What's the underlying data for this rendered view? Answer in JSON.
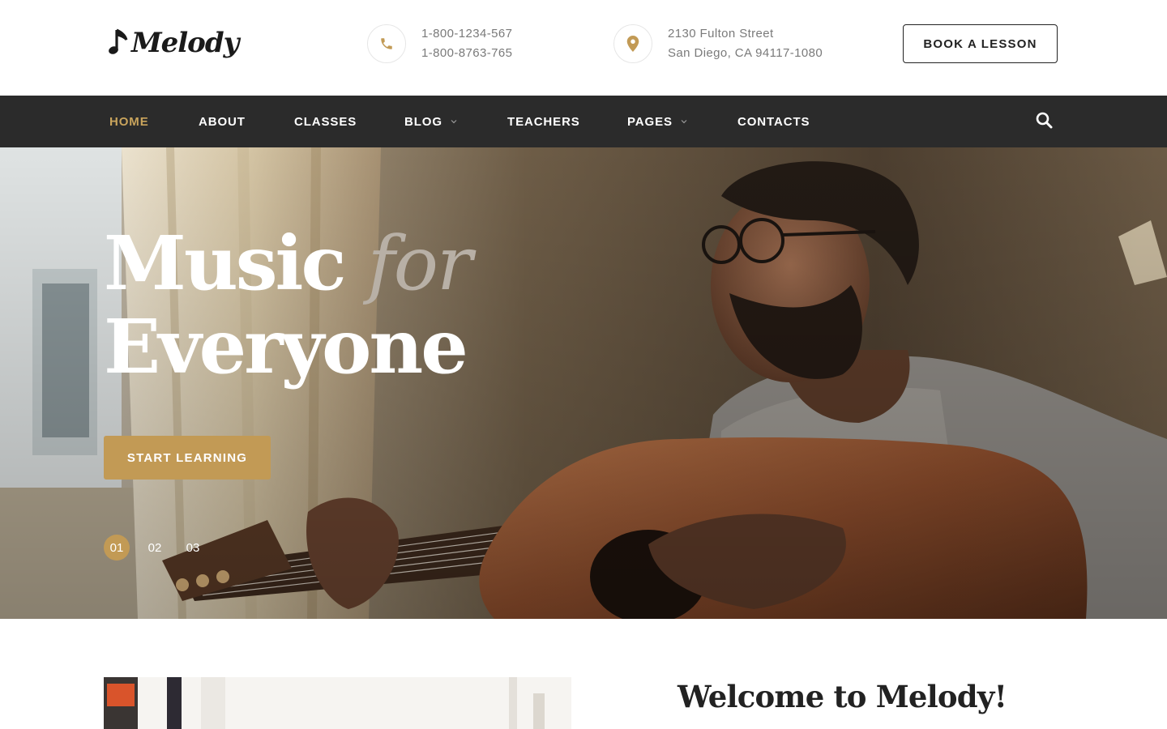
{
  "brand": {
    "name": "Melody"
  },
  "contacts": {
    "phone": {
      "icon": "phone-icon",
      "line1": "1-800-1234-567",
      "line2": "1-800-8763-765"
    },
    "address": {
      "icon": "location-pin-icon",
      "line1": "2130 Fulton Street",
      "line2": "San Diego, CA 94117-1080"
    }
  },
  "header": {
    "cta_label": "BOOK A LESSON"
  },
  "nav": {
    "items": [
      {
        "label": "HOME",
        "active": true
      },
      {
        "label": "ABOUT"
      },
      {
        "label": "CLASSES"
      },
      {
        "label": "BLOG",
        "dropdown": true
      },
      {
        "label": "TEACHERS"
      },
      {
        "label": "PAGES",
        "dropdown": true
      },
      {
        "label": "CONTACTS"
      }
    ],
    "search_icon": "search-icon"
  },
  "hero": {
    "title_word1": "Music",
    "title_word2": "for",
    "title_line2": "Everyone",
    "cta_label": "START LEARNING",
    "slides": [
      "01",
      "02",
      "03"
    ],
    "active_slide": "01"
  },
  "welcome": {
    "title": "Welcome to Melody!"
  },
  "colors": {
    "accent": "#c29a55",
    "nav_bg": "#2b2b2b",
    "text_dark": "#222222",
    "text_muted": "#7a7a7a"
  }
}
